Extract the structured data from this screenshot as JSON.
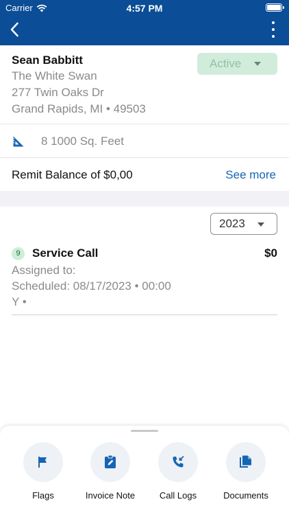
{
  "status_bar": {
    "carrier": "Carrier",
    "time": "4:57 PM"
  },
  "customer": {
    "name": "Sean Babbitt",
    "business": "The White Swan",
    "address_line1": "277 Twin Oaks Dr",
    "address_line2": "Grand Rapids, MI • 49503",
    "status": "Active"
  },
  "property": {
    "area": "8 1000 Sq. Feet",
    "icon": "ruler-triangle-icon"
  },
  "remit": {
    "text": "Remit Balance of $0,00",
    "link": "See more"
  },
  "filter": {
    "year": "2023"
  },
  "jobs": [
    {
      "count": "9",
      "title": "Service Call",
      "amount": "$0",
      "assigned": "Assigned to:",
      "scheduled": "Scheduled: 08/17/2023 • 00:00",
      "extra": "Y •"
    }
  ],
  "actions": [
    {
      "label": "Flags",
      "icon": "flag-icon"
    },
    {
      "label": "Invoice Note",
      "icon": "edit-note-icon"
    },
    {
      "label": "Call Logs",
      "icon": "incoming-call-icon"
    },
    {
      "label": "Documents",
      "icon": "documents-icon"
    }
  ],
  "colors": {
    "header": "#0b4d96",
    "accent": "#1565b5",
    "active_bg": "#d2ecdb"
  }
}
